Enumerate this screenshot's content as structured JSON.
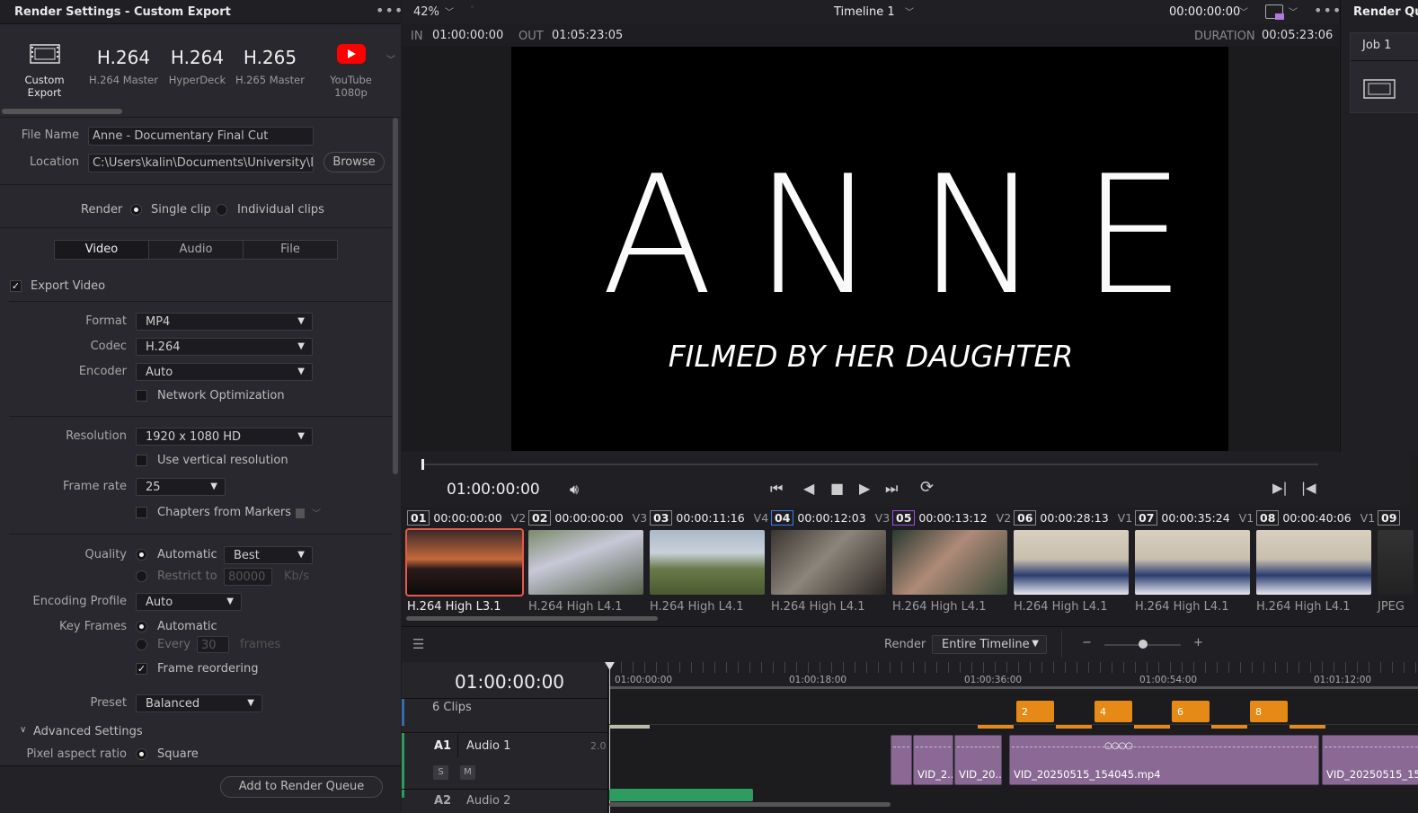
{
  "left_panel": {
    "title": "Render Settings - Custom Export",
    "presets": [
      {
        "big": "",
        "label": "Custom Export",
        "icon": "film-icon"
      },
      {
        "big": "H.264",
        "label": "H.264 Master"
      },
      {
        "big": "H.264",
        "label": "HyperDeck"
      },
      {
        "big": "H.265",
        "label": "H.265 Master"
      },
      {
        "big": "",
        "label": "YouTube 1080p",
        "icon": "youtube-icon"
      }
    ],
    "file_name_label": "File Name",
    "file_name": "Anne - Documentary Final Cut",
    "location_label": "Location",
    "location": "C:\\Users\\kalin\\Documents\\University\\Doc",
    "browse": "Browse",
    "render_label": "Render",
    "single_clip": "Single clip",
    "individual_clips": "Individual clips",
    "tabs": [
      "Video",
      "Audio",
      "File"
    ],
    "export_video": "Export Video",
    "format_label": "Format",
    "format": "MP4",
    "codec_label": "Codec",
    "codec": "H.264",
    "encoder_label": "Encoder",
    "encoder": "Auto",
    "network_opt": "Network Optimization",
    "resolution_label": "Resolution",
    "resolution": "1920 x 1080 HD",
    "vertical_res": "Use vertical resolution",
    "frame_rate_label": "Frame rate",
    "frame_rate": "25",
    "chapters": "Chapters from Markers",
    "quality_label": "Quality",
    "quality_auto": "Automatic",
    "quality_best": "Best",
    "restrict_to": "Restrict to",
    "restrict_value": "80000",
    "restrict_unit": "Kb/s",
    "encoding_profile_label": "Encoding Profile",
    "encoding_profile": "Auto",
    "key_frames_label": "Key Frames",
    "key_auto": "Automatic",
    "key_every": "Every",
    "key_every_value": "30",
    "key_frames_unit": "frames",
    "frame_reordering": "Frame reordering",
    "preset_label": "Preset",
    "preset": "Balanced",
    "advanced": "Advanced Settings",
    "pixel_aspect_label": "Pixel aspect ratio",
    "pixel_aspect": "Square",
    "add_to_queue": "Add to Render Queue"
  },
  "viewer": {
    "zoom": "42%",
    "timeline_name": "Timeline 1",
    "timecode_top": "00:00:00:00",
    "in_label": "IN",
    "in_value": "01:00:00:00",
    "out_label": "OUT",
    "out_value": "01:05:23:05",
    "duration_label": "DURATION",
    "duration_value": "00:05:23:06",
    "title_text": "ANNE",
    "subtitle_text": "FILMED BY HER DAUGHTER",
    "current_tc": "01:00:00:00"
  },
  "render_queue": {
    "title": "Render Qu",
    "job": "Job 1"
  },
  "clips": [
    {
      "num": "01",
      "tc": "00:00:00:00",
      "track": "V2",
      "fmt": "H.264 High L3.1"
    },
    {
      "num": "02",
      "tc": "00:00:00:00",
      "track": "V3",
      "fmt": "H.264 High L4.1"
    },
    {
      "num": "03",
      "tc": "00:00:11:16",
      "track": "V4",
      "fmt": "H.264 High L4.1"
    },
    {
      "num": "04",
      "tc": "00:00:12:03",
      "track": "V3",
      "fmt": "H.264 High L4.1"
    },
    {
      "num": "05",
      "tc": "00:00:13:12",
      "track": "V2",
      "fmt": "H.264 High L4.1"
    },
    {
      "num": "06",
      "tc": "00:00:28:13",
      "track": "V1",
      "fmt": "H.264 High L4.1"
    },
    {
      "num": "07",
      "tc": "00:00:35:24",
      "track": "V1",
      "fmt": "H.264 High L4.1"
    },
    {
      "num": "08",
      "tc": "00:00:40:06",
      "track": "V1",
      "fmt": "H.264 High L4.1"
    },
    {
      "num": "09",
      "tc": "",
      "track": "",
      "fmt": "JPEG"
    }
  ],
  "timeline": {
    "render_label": "Render",
    "render_value": "Entire Timeline",
    "timecode": "01:00:00:00",
    "ruler": [
      "01:00:00:00",
      "01:00:18:00",
      "01:00:36:00",
      "01:00:54:00",
      "01:01:12:00"
    ],
    "clips_label": "6 Clips",
    "orange": [
      "2",
      "4",
      "6",
      "8"
    ],
    "a1": "A1",
    "audio1": "Audio 1",
    "a1_ch": "2.0",
    "solo": "S",
    "mute": "M",
    "a2": "A2",
    "audio2": "Audio 2",
    "audio_clips": [
      "VID_2...",
      "VID_20...",
      "VID_20250515_154045.mp4",
      "VID_20250515_15..."
    ]
  }
}
